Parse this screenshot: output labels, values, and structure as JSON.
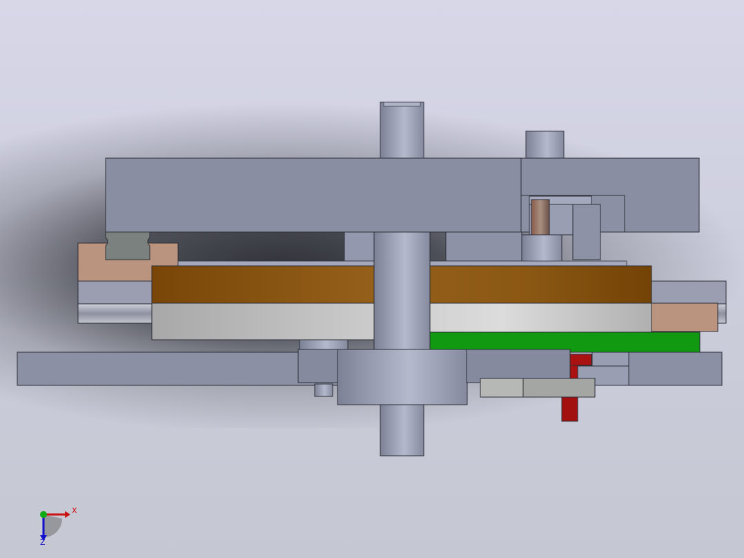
{
  "viewport": {
    "background_top": "#d7d7e8",
    "background_bottom": "#c5c7d2"
  },
  "parts": [
    {
      "name": "top-plate",
      "color": "#8a8ea3"
    },
    {
      "name": "main-shaft",
      "color": "#9498ad"
    },
    {
      "name": "brown-disk",
      "color": "#8a5410"
    },
    {
      "name": "silver-disk",
      "color": "#c4c4c4"
    },
    {
      "name": "linear-rail",
      "color": "#9a9eb0"
    },
    {
      "name": "slider-block",
      "color": "#bb9480"
    },
    {
      "name": "green-plate",
      "color": "#119911"
    },
    {
      "name": "red-pin",
      "color": "#aa1111"
    },
    {
      "name": "base-plate",
      "color": "#8c90a5"
    },
    {
      "name": "hub-collar",
      "color": "#959aaf"
    }
  ],
  "axis_triad": {
    "x_label": "X",
    "y_label": "Y",
    "z_label": "Z",
    "x_color": "#cc1111",
    "y_color": "#11aa11",
    "z_color": "#1111cc"
  }
}
